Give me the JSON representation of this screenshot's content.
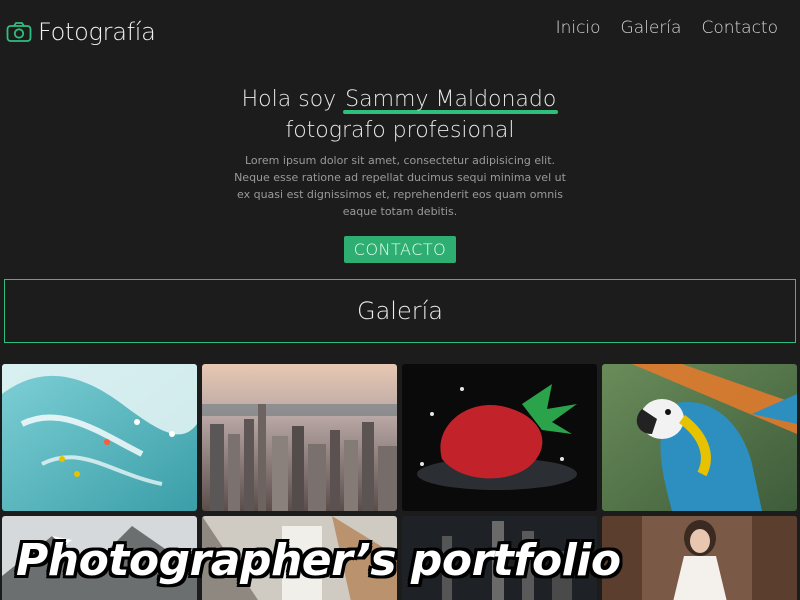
{
  "header": {
    "brand": "Fotografía",
    "brand_icon": "camera-icon",
    "nav": [
      "Inicio",
      "Galería",
      "Contacto"
    ]
  },
  "hero": {
    "greeting": "Hola soy",
    "name": "Sammy Maldonado",
    "subtitle": "fotografo profesional",
    "text": "Lorem ipsum dolor sit amet, consectetur adipisicing elit. Neque esse ratione ad repellat ducimus sequi minima vel ut ex quasi est dignissimos et, reprehenderit eos quam omnis eaque totam debitis.",
    "cta": "CONTACTO"
  },
  "gallery": {
    "title": "Galería",
    "photos_row1": [
      "surfers",
      "city skyline",
      "strawberry splash",
      "macaw parrot"
    ],
    "photos_row2": [
      "mountains",
      "building",
      "city night",
      "woman in forest"
    ]
  },
  "caption": "Photographer’s portfolio",
  "colors": {
    "background": "#1c1c1c",
    "accent": "#2fbf7d",
    "button": "#2fae72"
  }
}
